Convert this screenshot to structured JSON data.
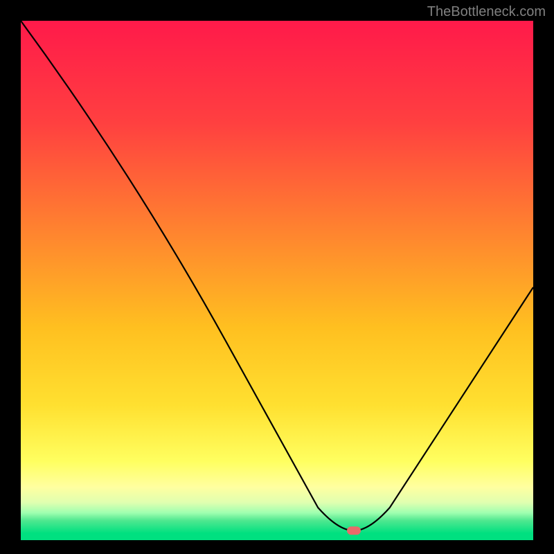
{
  "attribution": "TheBottleneck.com",
  "chart_data": {
    "type": "line",
    "title": "",
    "xlabel": "",
    "ylabel": "",
    "xlim": [
      0,
      100
    ],
    "ylim": [
      0,
      100
    ],
    "gradient_stops": [
      {
        "offset": 0,
        "color": "#ff1a4a"
      },
      {
        "offset": 20,
        "color": "#ff4040"
      },
      {
        "offset": 40,
        "color": "#ff8030"
      },
      {
        "offset": 60,
        "color": "#ffc020"
      },
      {
        "offset": 75,
        "color": "#ffe030"
      },
      {
        "offset": 86,
        "color": "#ffff60"
      },
      {
        "offset": 91,
        "color": "#ffffa0"
      },
      {
        "offset": 94,
        "color": "#e0ffb0"
      },
      {
        "offset": 96,
        "color": "#a0ffb0"
      },
      {
        "offset": 97.5,
        "color": "#50e890"
      },
      {
        "offset": 100,
        "color": "#00e080"
      }
    ],
    "bottom_band_color": "#00e080",
    "curve": {
      "description": "V-shaped bottleneck curve with minimum near x=65",
      "points": [
        {
          "x": 0,
          "y": 100
        },
        {
          "x": 22,
          "y": 70
        },
        {
          "x": 58,
          "y": 5
        },
        {
          "x": 62,
          "y": 0.5
        },
        {
          "x": 68,
          "y": 0.5
        },
        {
          "x": 72,
          "y": 5
        },
        {
          "x": 100,
          "y": 48
        }
      ]
    },
    "marker": {
      "x": 65,
      "y": 0.5,
      "color": "#e86a6a",
      "shape": "rounded-rect"
    }
  }
}
